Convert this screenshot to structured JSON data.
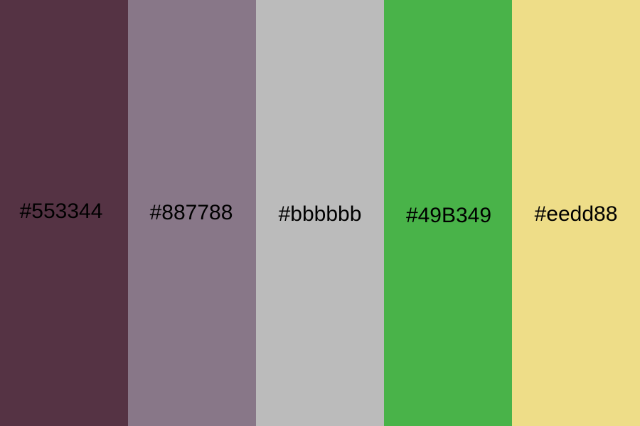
{
  "palette": {
    "swatches": [
      {
        "label": "#553344",
        "color": "#553344"
      },
      {
        "label": "#887788",
        "color": "#887788"
      },
      {
        "label": "#bbbbbb",
        "color": "#bbbbbb"
      },
      {
        "label": "#49B349",
        "color": "#49B349"
      },
      {
        "label": "#eedd88",
        "color": "#eedd88"
      }
    ]
  }
}
